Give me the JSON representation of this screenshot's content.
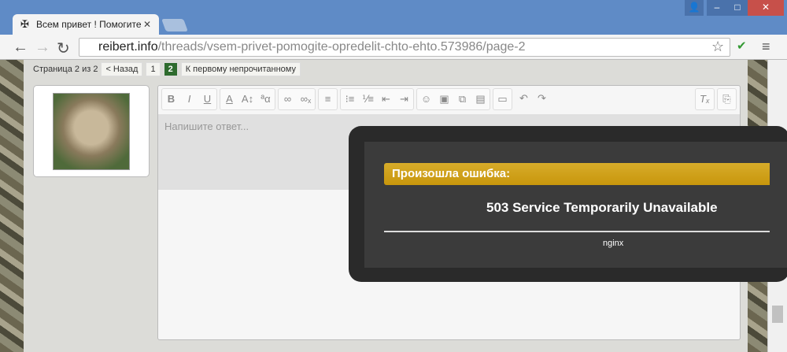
{
  "browser": {
    "tab_title": "Всем привет ! Помогите",
    "url_domain": "reibert.info",
    "url_path": "/threads/vsem-privet-pomogite-opredelit-chto-ehto.573986/page-2"
  },
  "pager": {
    "label": "Страница 2 из 2",
    "back": "< Назад",
    "pages": [
      "1",
      "2"
    ],
    "first_unread": "К первому непрочитанному"
  },
  "editor": {
    "placeholder": "Напишите ответ..."
  },
  "error": {
    "title": "Произошла ошибка:",
    "message": "503 Service Temporarily Unavailable",
    "server": "nginx"
  }
}
